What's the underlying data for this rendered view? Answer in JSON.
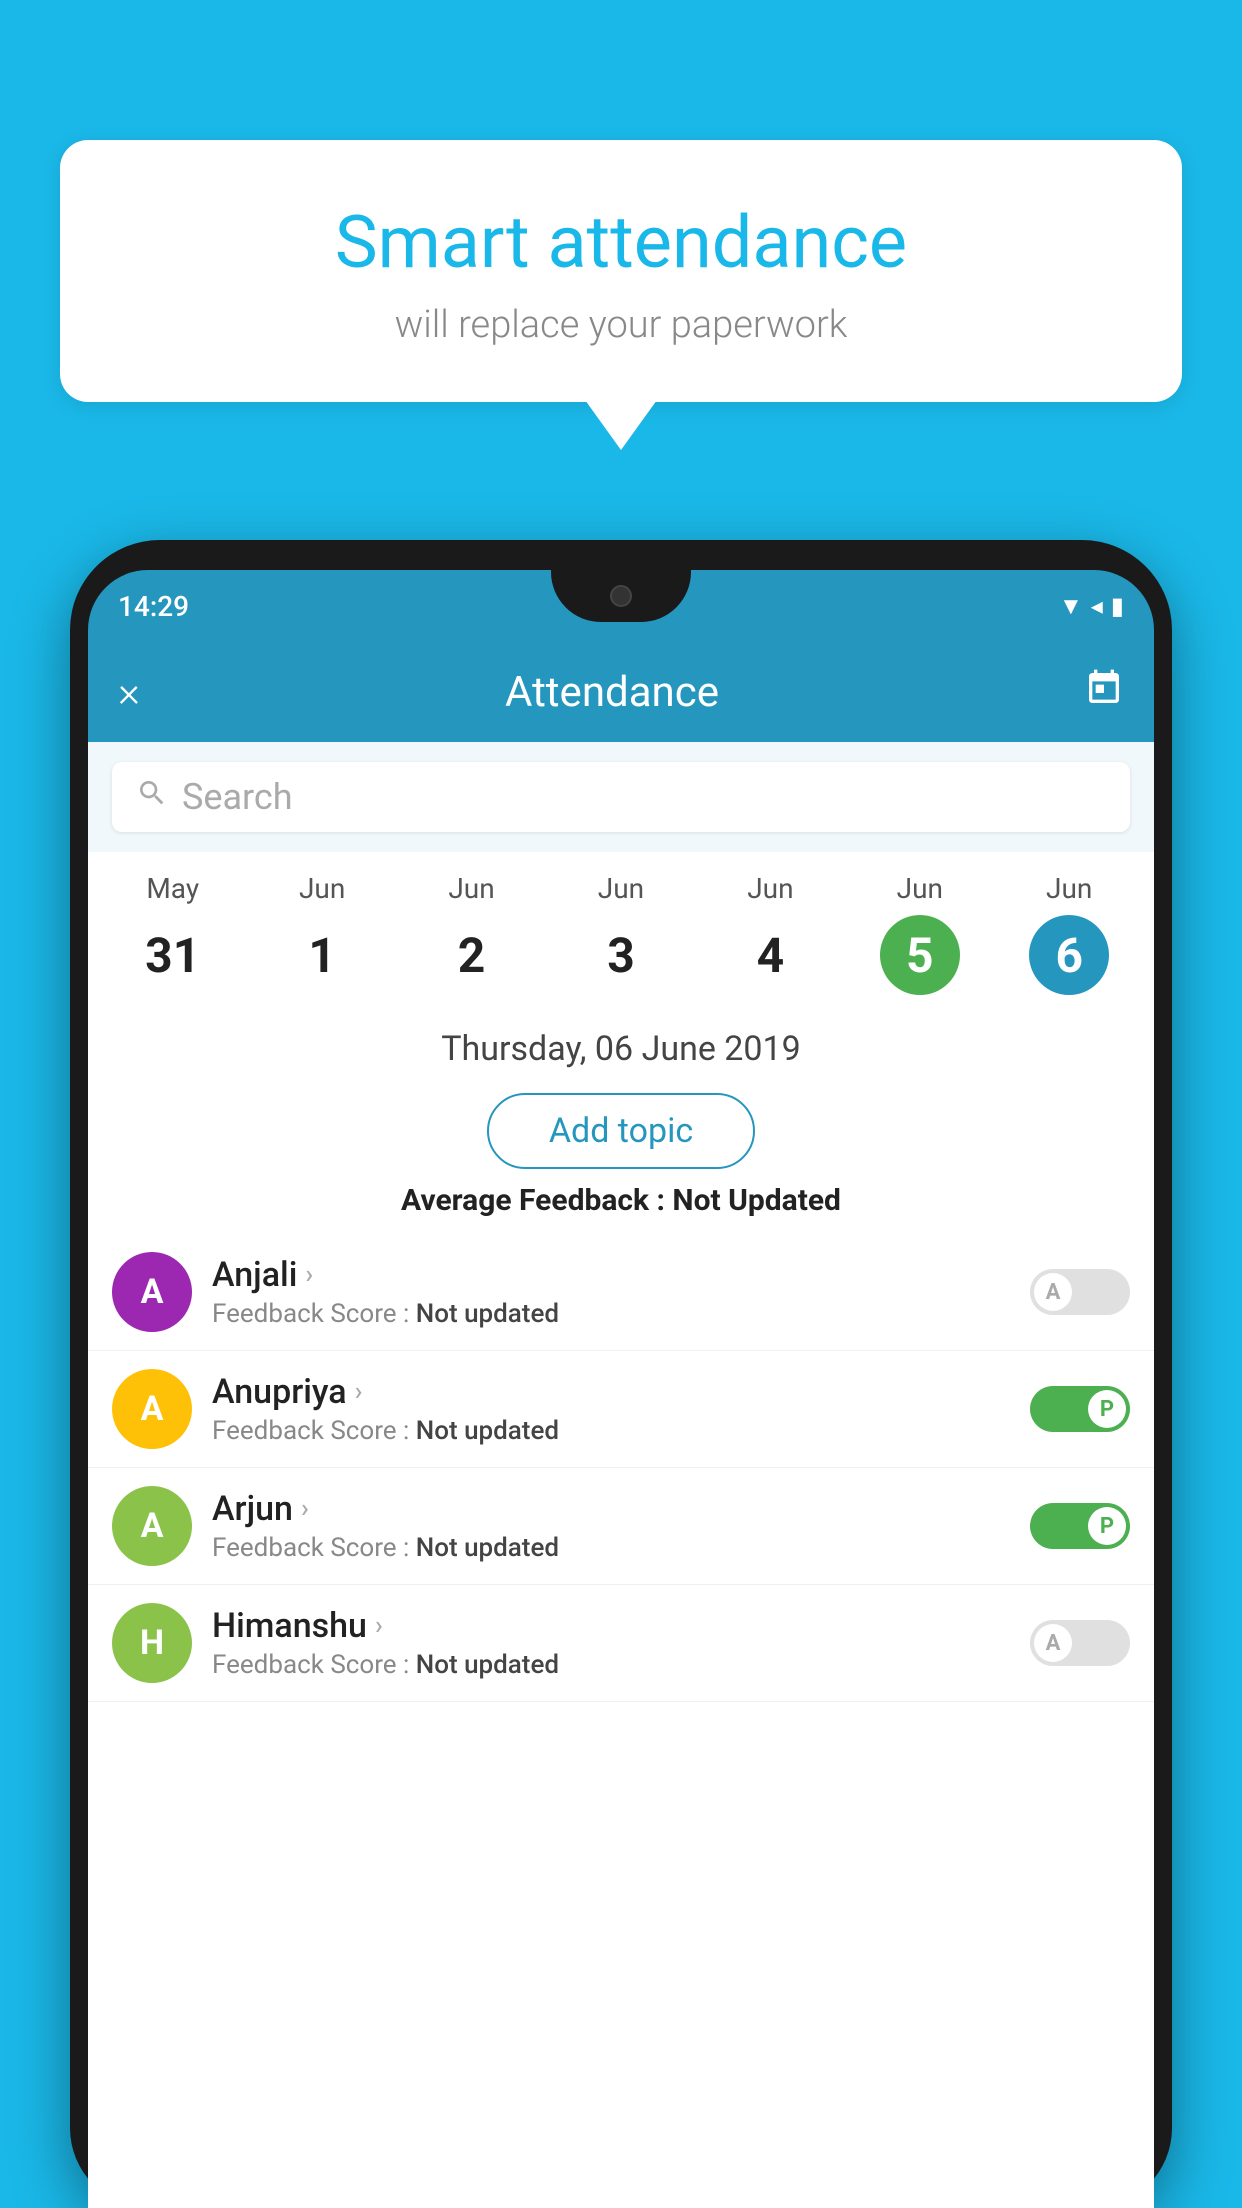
{
  "background_color": "#1ab8e8",
  "speech_bubble": {
    "title": "Smart attendance",
    "subtitle": "will replace your paperwork"
  },
  "status_bar": {
    "time": "14:29",
    "wifi_icon": "▼",
    "signal_icon": "▲",
    "battery_icon": "▮"
  },
  "app_header": {
    "title": "Attendance",
    "close_label": "×",
    "calendar_icon": "📅"
  },
  "search": {
    "placeholder": "Search"
  },
  "dates": [
    {
      "month": "May",
      "day": "31",
      "state": "normal"
    },
    {
      "month": "Jun",
      "day": "1",
      "state": "normal"
    },
    {
      "month": "Jun",
      "day": "2",
      "state": "normal"
    },
    {
      "month": "Jun",
      "day": "3",
      "state": "normal"
    },
    {
      "month": "Jun",
      "day": "4",
      "state": "normal"
    },
    {
      "month": "Jun",
      "day": "5",
      "state": "today"
    },
    {
      "month": "Jun",
      "day": "6",
      "state": "selected"
    }
  ],
  "selected_date": "Thursday, 06 June 2019",
  "add_topic_label": "Add topic",
  "avg_feedback": {
    "label": "Average Feedback : ",
    "value": "Not Updated"
  },
  "students": [
    {
      "name": "Anjali",
      "avatar_letter": "A",
      "avatar_color": "#9c27b0",
      "feedback_label": "Feedback Score : ",
      "feedback_value": "Not updated",
      "status": "absent"
    },
    {
      "name": "Anupriya",
      "avatar_letter": "A",
      "avatar_color": "#ffc107",
      "feedback_label": "Feedback Score : ",
      "feedback_value": "Not updated",
      "status": "present"
    },
    {
      "name": "Arjun",
      "avatar_letter": "A",
      "avatar_color": "#8bc34a",
      "feedback_label": "Feedback Score : ",
      "feedback_value": "Not updated",
      "status": "present"
    },
    {
      "name": "Himanshu",
      "avatar_letter": "H",
      "avatar_color": "#8bc34a",
      "feedback_label": "Feedback Score : ",
      "feedback_value": "Not updated",
      "status": "absent"
    }
  ]
}
